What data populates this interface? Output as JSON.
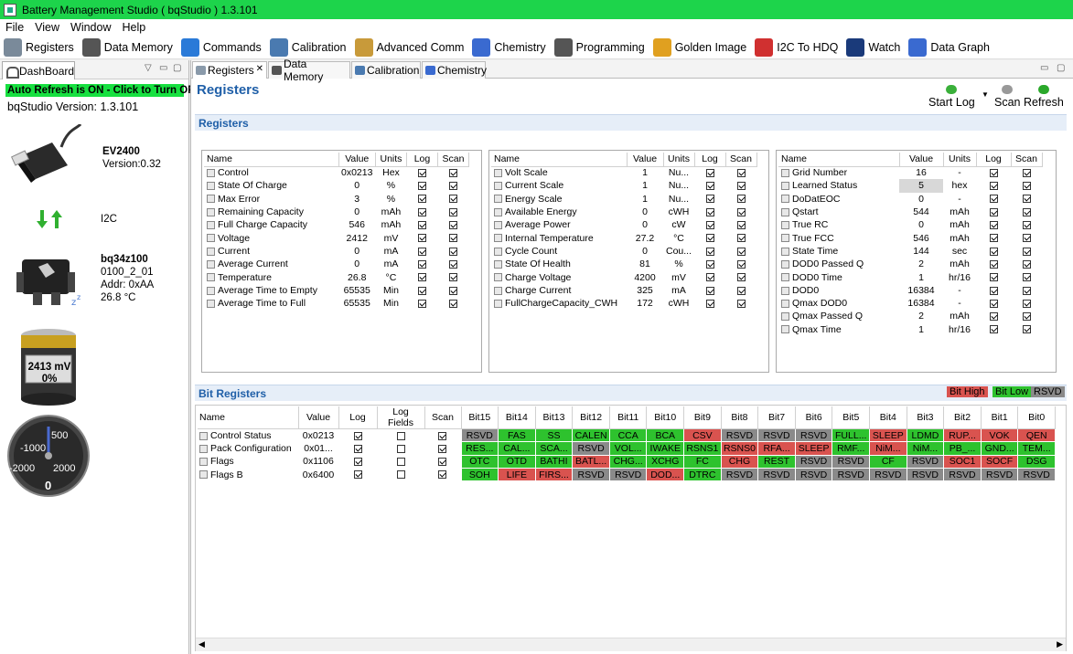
{
  "window": {
    "title": "Battery Management Studio ( bqStudio ) 1.3.101"
  },
  "menu": [
    "File",
    "View",
    "Window",
    "Help"
  ],
  "toolbar": [
    {
      "label": "Registers",
      "icon": "gear-icon",
      "color": "#7a8a9a"
    },
    {
      "label": "Data Memory",
      "icon": "memory-icon",
      "color": "#555"
    },
    {
      "label": "Commands",
      "icon": "commands-icon",
      "color": "#2a7ad8"
    },
    {
      "label": "Calibration",
      "icon": "calibration-icon",
      "color": "#4a7ab0"
    },
    {
      "label": "Advanced Comm",
      "icon": "advanced-comm-icon",
      "color": "#c89a3a"
    },
    {
      "label": "Chemistry",
      "icon": "flask-icon",
      "color": "#3a6ad0"
    },
    {
      "label": "Programming",
      "icon": "programming-icon",
      "color": "#555"
    },
    {
      "label": "Golden Image",
      "icon": "golden-image-icon",
      "color": "#e0a020"
    },
    {
      "label": "I2C To HDQ",
      "icon": "i2c-hdq-icon",
      "color": "#d03030"
    },
    {
      "label": "Watch",
      "icon": "watch-icon",
      "color": "#1a3a7a"
    },
    {
      "label": "Data Graph",
      "icon": "data-graph-icon",
      "color": "#3a6ad0"
    }
  ],
  "dashboard": {
    "tab": "DashBoard",
    "auto_refresh": "Auto Refresh is ON - Click to Turn OFF",
    "version": "bqStudio Version:  1.3.101",
    "adapter": "EV2400",
    "adapter_version": "Version:0.32",
    "bus": "I2C",
    "device": "bq34z100",
    "device_fw": "0100_2_01",
    "device_addr": "Addr: 0xAA",
    "device_temp": "26.8 °C",
    "battery_voltage": "2413 mV",
    "battery_percent": "0%",
    "gauge_ticks": [
      "500",
      "-1000",
      "-2000",
      "2000"
    ],
    "gauge_value": "0"
  },
  "tabs": [
    "Registers",
    "Data Memory",
    "Calibration",
    "Chemistry"
  ],
  "page": {
    "title": "Registers",
    "start_log": "Start Log",
    "scan": "Scan",
    "refresh": "Refresh",
    "registers_section": "Registers",
    "bit_section": "Bit Registers",
    "legend_high": "Bit High",
    "legend_low": "Bit Low",
    "legend_rsvd": "RSVD",
    "colors": {
      "high": "#d9534f",
      "low": "#2ec22e",
      "rsvd": "#8a8a8a"
    }
  },
  "reg_headers": [
    "Name",
    "Value",
    "Units",
    "Log",
    "Scan"
  ],
  "reg_tables": [
    [
      {
        "name": "Control",
        "value": "0x0213",
        "units": "Hex",
        "log": true,
        "scan": true
      },
      {
        "name": "State Of Charge",
        "value": "0",
        "units": "%",
        "log": true,
        "scan": true
      },
      {
        "name": "Max Error",
        "value": "3",
        "units": "%",
        "log": true,
        "scan": true
      },
      {
        "name": "Remaining Capacity",
        "value": "0",
        "units": "mAh",
        "log": true,
        "scan": true
      },
      {
        "name": "Full Charge Capacity",
        "value": "546",
        "units": "mAh",
        "log": true,
        "scan": true
      },
      {
        "name": "Voltage",
        "value": "2412",
        "units": "mV",
        "log": true,
        "scan": true
      },
      {
        "name": "Current",
        "value": "0",
        "units": "mA",
        "log": true,
        "scan": true
      },
      {
        "name": "Average Current",
        "value": "0",
        "units": "mA",
        "log": true,
        "scan": true
      },
      {
        "name": "Temperature",
        "value": "26.8",
        "units": "°C",
        "log": true,
        "scan": true
      },
      {
        "name": "Average Time to Empty",
        "value": "65535",
        "units": "Min",
        "log": true,
        "scan": true
      },
      {
        "name": "Average Time to Full",
        "value": "65535",
        "units": "Min",
        "log": true,
        "scan": true
      }
    ],
    [
      {
        "name": "Volt Scale",
        "value": "1",
        "units": "Nu...",
        "log": true,
        "scan": true
      },
      {
        "name": "Current Scale",
        "value": "1",
        "units": "Nu...",
        "log": true,
        "scan": true
      },
      {
        "name": "Energy Scale",
        "value": "1",
        "units": "Nu...",
        "log": true,
        "scan": true
      },
      {
        "name": "Available Energy",
        "value": "0",
        "units": "cWH",
        "log": true,
        "scan": true
      },
      {
        "name": "Average Power",
        "value": "0",
        "units": "cW",
        "log": true,
        "scan": true
      },
      {
        "name": "Internal Temperature",
        "value": "27.2",
        "units": "°C",
        "log": true,
        "scan": true
      },
      {
        "name": "Cycle Count",
        "value": "0",
        "units": "Cou...",
        "log": true,
        "scan": true
      },
      {
        "name": "State Of Health",
        "value": "81",
        "units": "%",
        "log": true,
        "scan": true
      },
      {
        "name": "Charge Voltage",
        "value": "4200",
        "units": "mV",
        "log": true,
        "scan": true
      },
      {
        "name": "Charge Current",
        "value": "325",
        "units": "mA",
        "log": true,
        "scan": true
      },
      {
        "name": "FullChargeCapacity_CWH",
        "value": "172",
        "units": "cWH",
        "log": true,
        "scan": true
      }
    ],
    [
      {
        "name": "Grid Number",
        "value": "16",
        "units": "-",
        "log": true,
        "scan": true
      },
      {
        "name": "Learned Status",
        "value": "5",
        "units": "hex",
        "log": true,
        "scan": true
      },
      {
        "name": "DoDatEOC",
        "value": "0",
        "units": "-",
        "log": true,
        "scan": true
      },
      {
        "name": "Qstart",
        "value": "544",
        "units": "mAh",
        "log": true,
        "scan": true
      },
      {
        "name": "True RC",
        "value": "0",
        "units": "mAh",
        "log": true,
        "scan": true
      },
      {
        "name": "True FCC",
        "value": "546",
        "units": "mAh",
        "log": true,
        "scan": true
      },
      {
        "name": "State Time",
        "value": "144",
        "units": "sec",
        "log": true,
        "scan": true
      },
      {
        "name": "DOD0 Passed Q",
        "value": "2",
        "units": "mAh",
        "log": true,
        "scan": true
      },
      {
        "name": "DOD0 Time",
        "value": "1",
        "units": "hr/16",
        "log": true,
        "scan": true
      },
      {
        "name": "DOD0",
        "value": "16384",
        "units": "-",
        "log": true,
        "scan": true
      },
      {
        "name": "Qmax DOD0",
        "value": "16384",
        "units": "-",
        "log": true,
        "scan": true
      },
      {
        "name": "Qmax Passed Q",
        "value": "2",
        "units": "mAh",
        "log": true,
        "scan": true
      },
      {
        "name": "Qmax Time",
        "value": "1",
        "units": "hr/16",
        "log": true,
        "scan": true
      }
    ]
  ],
  "bit_headers": [
    "Name",
    "Value",
    "Log",
    "Log Fields",
    "Scan",
    "Bit15",
    "Bit14",
    "Bit13",
    "Bit12",
    "Bit11",
    "Bit10",
    "Bit9",
    "Bit8",
    "Bit7",
    "Bit6",
    "Bit5",
    "Bit4",
    "Bit3",
    "Bit2",
    "Bit1",
    "Bit0"
  ],
  "bit_rows": [
    {
      "name": "Control Status",
      "value": "0x0213",
      "log": true,
      "fields": false,
      "scan": true,
      "bits": [
        [
          "RSVD",
          "r"
        ],
        [
          "FAS",
          "l"
        ],
        [
          "SS",
          "l"
        ],
        [
          "CALEN",
          "l"
        ],
        [
          "CCA",
          "l"
        ],
        [
          "BCA",
          "l"
        ],
        [
          "CSV",
          "h"
        ],
        [
          "RSVD",
          "r"
        ],
        [
          "RSVD",
          "r"
        ],
        [
          "RSVD",
          "r"
        ],
        [
          "FULL...",
          "l"
        ],
        [
          "SLEEP",
          "h"
        ],
        [
          "LDMD",
          "l"
        ],
        [
          "RUP...",
          "h"
        ],
        [
          "VOK",
          "h"
        ],
        [
          "QEN",
          "h"
        ]
      ]
    },
    {
      "name": "Pack Configuration",
      "value": "0x01...",
      "log": true,
      "fields": false,
      "scan": true,
      "bits": [
        [
          "RES...",
          "l"
        ],
        [
          "CAL...",
          "l"
        ],
        [
          "SCA...",
          "l"
        ],
        [
          "RSVD",
          "r"
        ],
        [
          "VOL...",
          "l"
        ],
        [
          "IWAKE",
          "l"
        ],
        [
          "RSNS1",
          "l"
        ],
        [
          "RSNS0",
          "h"
        ],
        [
          "RFA...",
          "h"
        ],
        [
          "SLEEP",
          "h"
        ],
        [
          "RMF...",
          "l"
        ],
        [
          "NiM...",
          "h"
        ],
        [
          "NiM...",
          "l"
        ],
        [
          "PB_...",
          "l"
        ],
        [
          "GND...",
          "l"
        ],
        [
          "TEM...",
          "l"
        ]
      ]
    },
    {
      "name": "Flags",
      "value": "0x1106",
      "log": true,
      "fields": false,
      "scan": true,
      "bits": [
        [
          "OTC",
          "l"
        ],
        [
          "OTD",
          "l"
        ],
        [
          "BATHI",
          "l"
        ],
        [
          "BATL...",
          "h"
        ],
        [
          "CHG...",
          "l"
        ],
        [
          "XCHG",
          "l"
        ],
        [
          "FC",
          "l"
        ],
        [
          "CHG",
          "h"
        ],
        [
          "REST",
          "l"
        ],
        [
          "RSVD",
          "r"
        ],
        [
          "RSVD",
          "r"
        ],
        [
          "CF",
          "l"
        ],
        [
          "RSVD",
          "r"
        ],
        [
          "SOC1",
          "h"
        ],
        [
          "SOCF",
          "h"
        ],
        [
          "DSG",
          "l"
        ]
      ]
    },
    {
      "name": "Flags B",
      "value": "0x6400",
      "log": true,
      "fields": false,
      "scan": true,
      "bits": [
        [
          "SOH",
          "l"
        ],
        [
          "LIFE",
          "h"
        ],
        [
          "FIRS...",
          "h"
        ],
        [
          "RSVD",
          "r"
        ],
        [
          "RSVD",
          "r"
        ],
        [
          "DOD...",
          "h"
        ],
        [
          "DTRC",
          "l"
        ],
        [
          "RSVD",
          "r"
        ],
        [
          "RSVD",
          "r"
        ],
        [
          "RSVD",
          "r"
        ],
        [
          "RSVD",
          "r"
        ],
        [
          "RSVD",
          "r"
        ],
        [
          "RSVD",
          "r"
        ],
        [
          "RSVD",
          "r"
        ],
        [
          "RSVD",
          "r"
        ],
        [
          "RSVD",
          "r"
        ]
      ]
    }
  ]
}
